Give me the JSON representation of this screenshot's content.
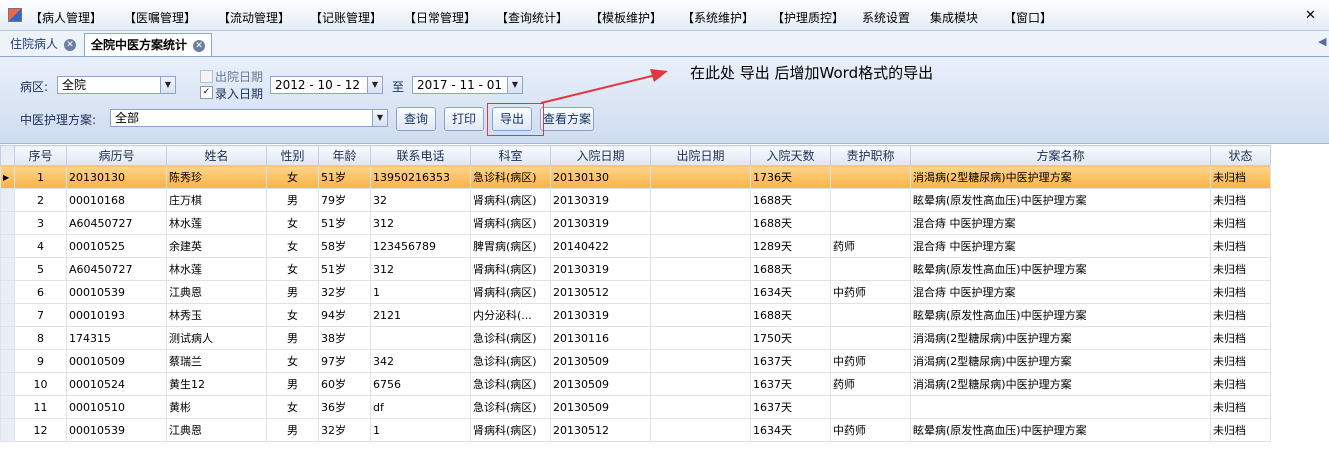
{
  "menu": [
    "【病人管理】",
    "【医嘱管理】",
    "【流动管理】",
    "【记账管理】",
    "【日常管理】",
    "【查询统计】",
    "【模板维护】",
    "【系统维护】",
    "【护理质控】",
    "系统设置",
    "集成模块",
    "【窗口】"
  ],
  "close_glyph": "✕",
  "tabs": [
    {
      "label": "住院病人"
    },
    {
      "label": "全院中医方案统计"
    }
  ],
  "filters": {
    "ward_label": "病区:",
    "ward_value": "全院",
    "discharge_date_label": "出院日期",
    "discharge_date_checked": false,
    "entry_date_label": "录入日期",
    "entry_date_checked": true,
    "date_from": "2012 - 10 - 12",
    "to_label": "至",
    "date_to": "2017 - 11 - 01",
    "plan_label": "中医护理方案:",
    "plan_value": "全部"
  },
  "buttons": {
    "query": "查询",
    "print": "打印",
    "export": "导出",
    "view_plan": "查看方案"
  },
  "annotation": "在此处 导出 后增加Word格式的导出",
  "table": {
    "columns": [
      "序号",
      "病历号",
      "姓名",
      "性别",
      "年龄",
      "联系电话",
      "科室",
      "入院日期",
      "出院日期",
      "入院天数",
      "责护职称",
      "方案名称",
      "状态"
    ],
    "rows": [
      [
        "1",
        "20130130",
        "陈秀珍",
        "女",
        "51岁",
        "13950216353",
        "急诊科(病区)",
        "20130130",
        "",
        "1736天",
        "",
        "消渴病(2型糖尿病)中医护理方案",
        "未归档"
      ],
      [
        "2",
        "00010168",
        "庄万棋",
        "男",
        "79岁",
        "32",
        "肾病科(病区)",
        "20130319",
        "",
        "1688天",
        "",
        "眩晕病(原发性高血压)中医护理方案",
        "未归档"
      ],
      [
        "3",
        "A60450727",
        "林水莲",
        "女",
        "51岁",
        "312",
        "肾病科(病区)",
        "20130319",
        "",
        "1688天",
        "",
        "混合痔 中医护理方案",
        "未归档"
      ],
      [
        "4",
        "00010525",
        "余建英",
        "女",
        "58岁",
        "123456789",
        "脾胃病(病区)",
        "20140422",
        "",
        "1289天",
        "药师",
        "混合痔 中医护理方案",
        "未归档"
      ],
      [
        "5",
        "A60450727",
        "林水莲",
        "女",
        "51岁",
        "312",
        "肾病科(病区)",
        "20130319",
        "",
        "1688天",
        "",
        "眩晕病(原发性高血压)中医护理方案",
        "未归档"
      ],
      [
        "6",
        "00010539",
        "江典恩",
        "男",
        "32岁",
        "1",
        "肾病科(病区)",
        "20130512",
        "",
        "1634天",
        "中药师",
        "混合痔 中医护理方案",
        "未归档"
      ],
      [
        "7",
        "00010193",
        "林秀玉",
        "女",
        "94岁",
        "2121",
        "内分泌科(...",
        "20130319",
        "",
        "1688天",
        "",
        "眩晕病(原发性高血压)中医护理方案",
        "未归档"
      ],
      [
        "8",
        "174315",
        "测试病人",
        "男",
        "38岁",
        "",
        "急诊科(病区)",
        "20130116",
        "",
        "1750天",
        "",
        "消渴病(2型糖尿病)中医护理方案",
        "未归档"
      ],
      [
        "9",
        "00010509",
        "蔡瑞兰",
        "女",
        "97岁",
        "342",
        "急诊科(病区)",
        "20130509",
        "",
        "1637天",
        "中药师",
        "消渴病(2型糖尿病)中医护理方案",
        "未归档"
      ],
      [
        "10",
        "00010524",
        "黄生12",
        "男",
        "60岁",
        "6756",
        "急诊科(病区)",
        "20130509",
        "",
        "1637天",
        "药师",
        "消渴病(2型糖尿病)中医护理方案",
        "未归档"
      ],
      [
        "11",
        "00010510",
        "黄彬",
        "女",
        "36岁",
        "df",
        "急诊科(病区)",
        "20130509",
        "",
        "1637天",
        "",
        "",
        "未归档"
      ],
      [
        "12",
        "00010539",
        "江典恩",
        "男",
        "32岁",
        "1",
        "肾病科(病区)",
        "20130512",
        "",
        "1634天",
        "中药师",
        "眩晕病(原发性高血压)中医护理方案",
        "未归档"
      ]
    ],
    "selected_row": 0
  },
  "colors": {
    "selected_row": "#f9b246",
    "annotation_arrow": "#e3373f"
  }
}
